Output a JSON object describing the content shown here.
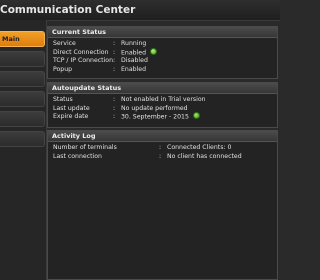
{
  "window": {
    "title": "Communication Center"
  },
  "sidebar": {
    "items": [
      {
        "label": "Main",
        "active": true
      },
      {
        "label": ""
      },
      {
        "label": ""
      },
      {
        "label": ""
      },
      {
        "label": ""
      },
      {
        "label": ""
      },
      {
        "label": ""
      }
    ]
  },
  "current_status": {
    "title": "Current Status",
    "rows": [
      {
        "label": "Service",
        "value": "Running"
      },
      {
        "label": "Direct Connection",
        "value": "Enabled"
      },
      {
        "label": "TCP / IP Connection",
        "value": "Disabled"
      },
      {
        "label": "Popup",
        "value": "Enabled"
      }
    ]
  },
  "autoupdate_status": {
    "title": "Autoupdate Status",
    "rows": [
      {
        "label": "Status",
        "value": "Not enabled in Trial version"
      },
      {
        "label": "Last update",
        "value": "No update performed"
      },
      {
        "label": "Expire date",
        "value": "30. September - 2015"
      }
    ]
  },
  "activity_log": {
    "title": "Activity Log",
    "rows": [
      {
        "label": "Number of terminals",
        "value": "Connected Clients: 0"
      },
      {
        "label": "Last connection",
        "value": "No client has connected"
      }
    ]
  },
  "colon": ":",
  "colors": {
    "accent": "#e8901a",
    "status_ok": "#43a917",
    "background": "#2a2a2a"
  },
  "icons": {
    "direct_connection_status": "green-status-icon",
    "expire_date_status": "green-check-icon"
  }
}
